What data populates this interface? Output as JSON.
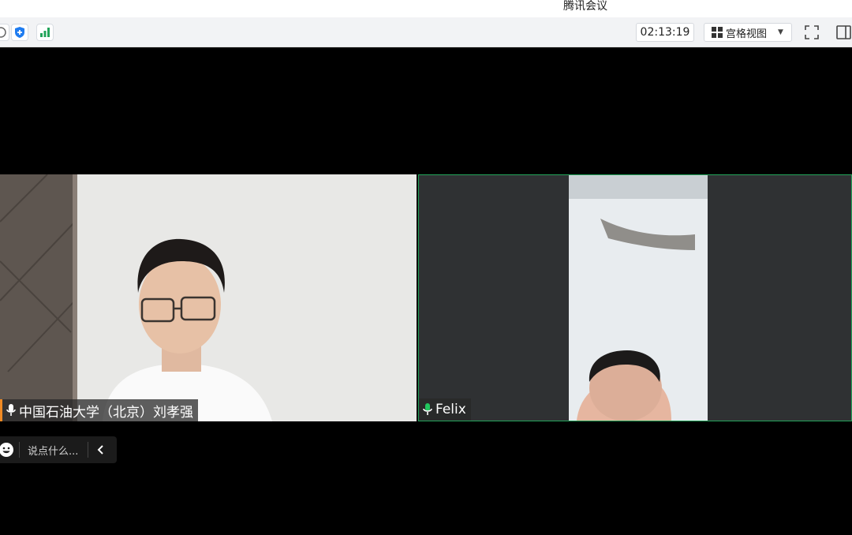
{
  "window": {
    "title": "腾讯会议"
  },
  "toolbar": {
    "icons": [
      "info-icon",
      "shield-icon",
      "signal-icon"
    ],
    "timer": "02:13:19",
    "view_label": "宫格视图",
    "accent": "#1f7cf0",
    "signal_color": "#22a45a"
  },
  "participants": [
    {
      "name": "中国石油大学（北京）刘孝强",
      "mic": "on",
      "highlight": "#f08a24"
    },
    {
      "name": "Felix",
      "mic": "speaking",
      "speaker_color": "#22a45a"
    }
  ],
  "chat": {
    "placeholder": "说点什么..."
  }
}
